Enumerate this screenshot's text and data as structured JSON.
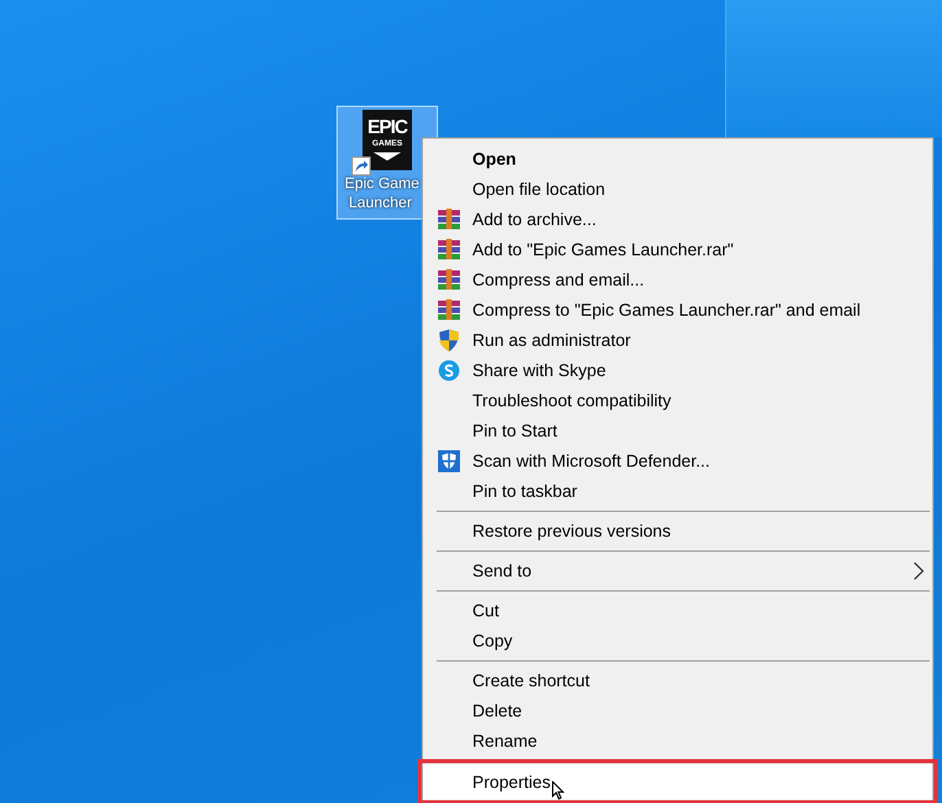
{
  "desktop_icon": {
    "logo_lines": [
      "EPIC",
      "GAMES"
    ],
    "label_lines": [
      "Epic Game",
      "Launcher"
    ],
    "selected": true,
    "shortcut": true
  },
  "context_menu": {
    "groups": [
      {
        "items": [
          {
            "label": "Open",
            "kind": "none",
            "default": true,
            "submenu": false,
            "highlighted": false
          },
          {
            "label": "Open file location",
            "kind": "none",
            "default": false,
            "submenu": false,
            "highlighted": false
          },
          {
            "label": "Add to archive...",
            "kind": "winrar",
            "default": false,
            "submenu": false,
            "highlighted": false
          },
          {
            "label": "Add to \"Epic Games Launcher.rar\"",
            "kind": "winrar",
            "default": false,
            "submenu": false,
            "highlighted": false
          },
          {
            "label": "Compress and email...",
            "kind": "winrar",
            "default": false,
            "submenu": false,
            "highlighted": false
          },
          {
            "label": "Compress to \"Epic Games Launcher.rar\" and email",
            "kind": "winrar",
            "default": false,
            "submenu": false,
            "highlighted": false
          },
          {
            "label": "Run as administrator",
            "kind": "shield",
            "default": false,
            "submenu": false,
            "highlighted": false
          },
          {
            "label": "Share with Skype",
            "kind": "skype",
            "default": false,
            "submenu": false,
            "highlighted": false
          },
          {
            "label": "Troubleshoot compatibility",
            "kind": "none",
            "default": false,
            "submenu": false,
            "highlighted": false
          },
          {
            "label": "Pin to Start",
            "kind": "none",
            "default": false,
            "submenu": false,
            "highlighted": false
          },
          {
            "label": "Scan with Microsoft Defender...",
            "kind": "defender",
            "default": false,
            "submenu": false,
            "highlighted": false
          },
          {
            "label": "Pin to taskbar",
            "kind": "none",
            "default": false,
            "submenu": false,
            "highlighted": false
          }
        ]
      },
      {
        "items": [
          {
            "label": "Restore previous versions",
            "kind": "none",
            "default": false,
            "submenu": false,
            "highlighted": false
          }
        ]
      },
      {
        "items": [
          {
            "label": "Send to",
            "kind": "none",
            "default": false,
            "submenu": true,
            "highlighted": false
          }
        ]
      },
      {
        "items": [
          {
            "label": "Cut",
            "kind": "none",
            "default": false,
            "submenu": false,
            "highlighted": false
          },
          {
            "label": "Copy",
            "kind": "none",
            "default": false,
            "submenu": false,
            "highlighted": false
          }
        ]
      },
      {
        "items": [
          {
            "label": "Create shortcut",
            "kind": "none",
            "default": false,
            "submenu": false,
            "highlighted": false
          },
          {
            "label": "Delete",
            "kind": "none",
            "default": false,
            "submenu": false,
            "highlighted": false
          },
          {
            "label": "Rename",
            "kind": "none",
            "default": false,
            "submenu": false,
            "highlighted": false
          }
        ]
      },
      {
        "items": [
          {
            "label": "Properties",
            "kind": "none",
            "default": false,
            "submenu": false,
            "highlighted": true
          }
        ]
      }
    ]
  }
}
